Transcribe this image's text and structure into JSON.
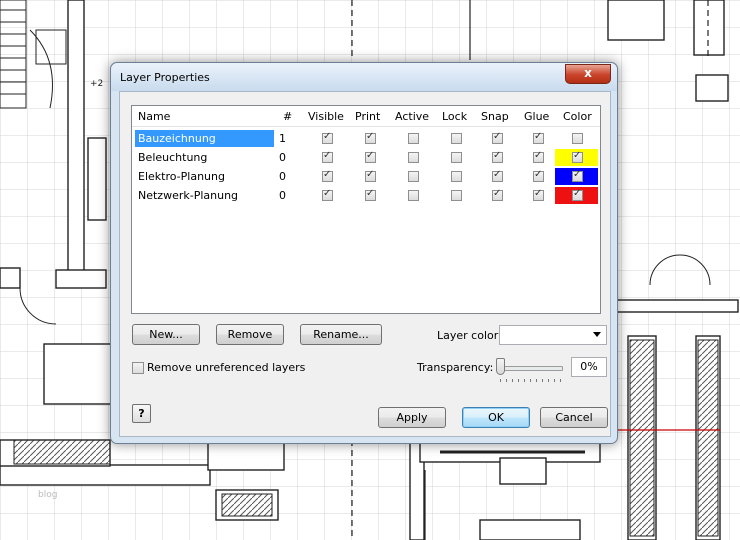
{
  "dialog": {
    "title": "Layer Properties",
    "close_label": "x"
  },
  "grid": {
    "columns": [
      "Name",
      "#",
      "Visible",
      "Print",
      "Active",
      "Lock",
      "Snap",
      "Glue",
      "Color"
    ],
    "layers": [
      {
        "name": "Bauzeichnung",
        "count": "1",
        "visible": true,
        "print": true,
        "active": false,
        "lock": false,
        "snap": true,
        "glue": true,
        "color_checked": false,
        "color": "",
        "selected": true
      },
      {
        "name": "Beleuchtung",
        "count": "0",
        "visible": true,
        "print": true,
        "active": false,
        "lock": false,
        "snap": true,
        "glue": true,
        "color_checked": true,
        "color": "#ffff00",
        "selected": false
      },
      {
        "name": "Elektro-Planung",
        "count": "0",
        "visible": true,
        "print": true,
        "active": false,
        "lock": false,
        "snap": true,
        "glue": true,
        "color_checked": true,
        "color": "#0000ff",
        "selected": false
      },
      {
        "name": "Netzwerk-Planung",
        "count": "0",
        "visible": true,
        "print": true,
        "active": false,
        "lock": false,
        "snap": true,
        "glue": true,
        "color_checked": true,
        "color": "#ee1111",
        "selected": false
      }
    ]
  },
  "buttons": {
    "new": "New...",
    "remove": "Remove",
    "rename": "Rename...",
    "apply": "Apply",
    "ok": "OK",
    "cancel": "Cancel",
    "help_icon": "?"
  },
  "options": {
    "layer_color_label": "Layer color:",
    "layer_color_value": "",
    "remove_unreferenced_label": "Remove unreferenced layers",
    "remove_unreferenced_checked": false,
    "transparency_label": "Transparency:",
    "transparency_value": "0%",
    "transparency_level": 0
  },
  "background": {
    "floor_plan_label": "+2",
    "watermark": "blog"
  }
}
